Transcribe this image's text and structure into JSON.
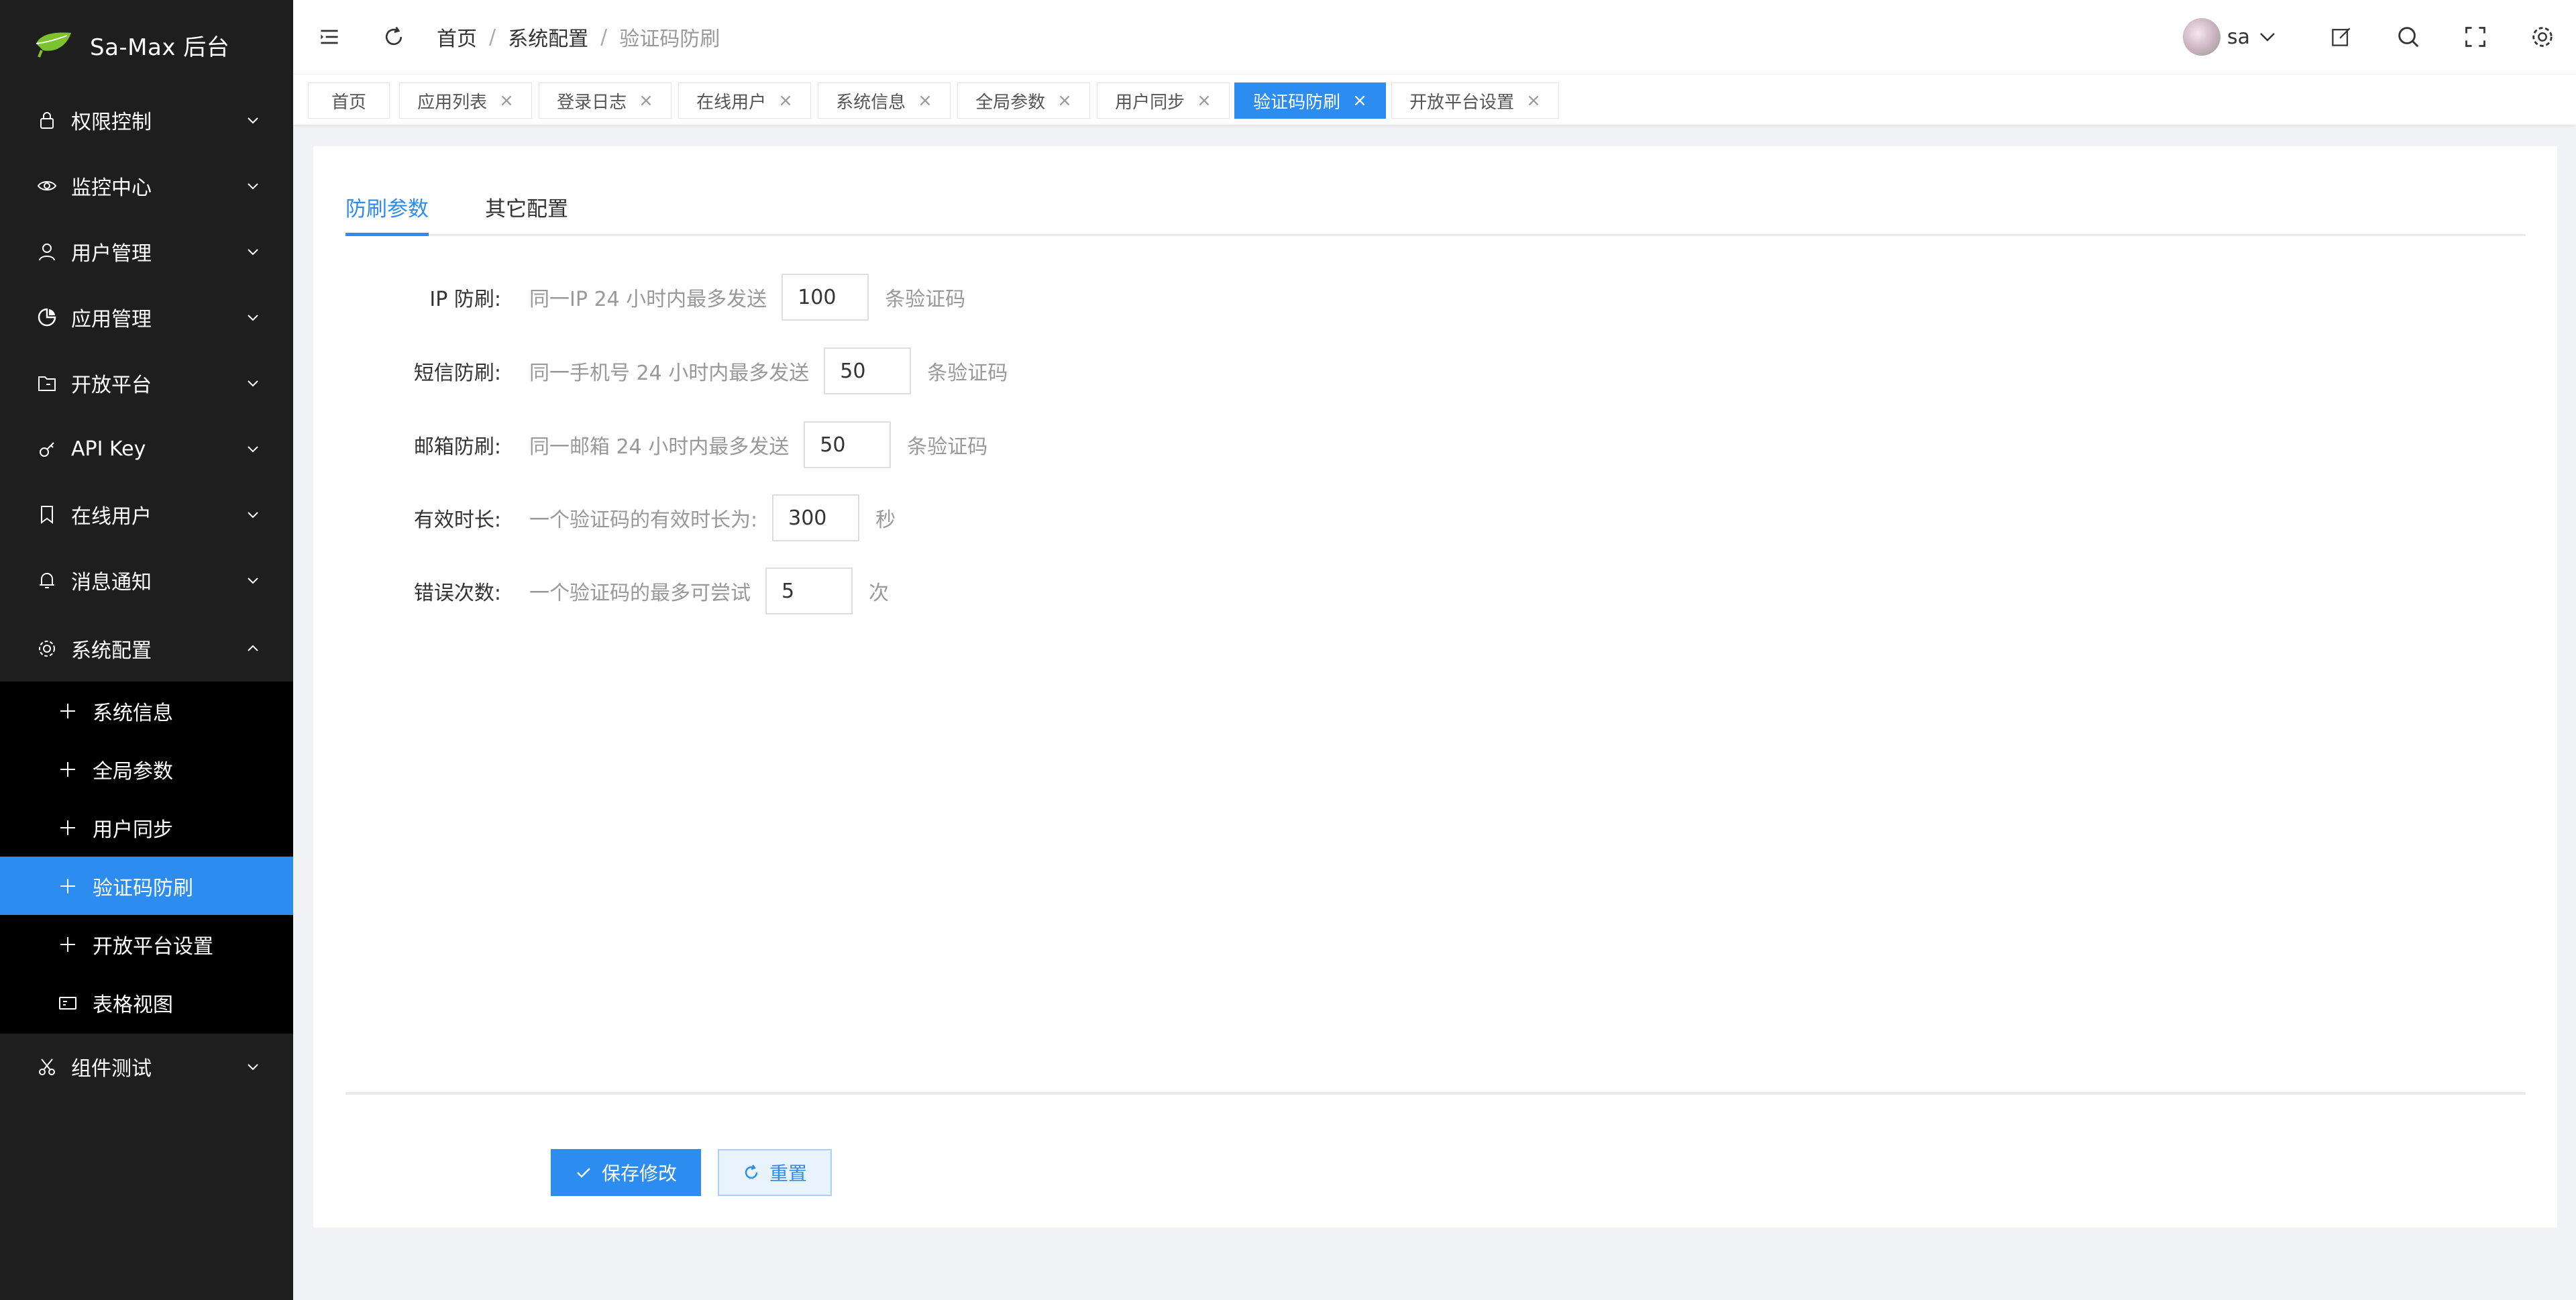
{
  "app": {
    "title": "Sa-Max 后台"
  },
  "sidebar": {
    "items": [
      {
        "label": "权限控制",
        "icon": "lock-icon"
      },
      {
        "label": "监控中心",
        "icon": "eye-icon"
      },
      {
        "label": "用户管理",
        "icon": "user-icon"
      },
      {
        "label": "应用管理",
        "icon": "chart-icon"
      },
      {
        "label": "开放平台",
        "icon": "folder-icon"
      },
      {
        "label": "API Key",
        "icon": "key-icon"
      },
      {
        "label": "在线用户",
        "icon": "bookmark-icon"
      },
      {
        "label": "消息通知",
        "icon": "bell-icon"
      },
      {
        "label": "系统配置",
        "icon": "gear-icon"
      },
      {
        "label": "组件测试",
        "icon": "scissors-icon"
      }
    ],
    "subitems": [
      {
        "label": "系统信息",
        "icon": "plus-icon"
      },
      {
        "label": "全局参数",
        "icon": "plus-icon"
      },
      {
        "label": "用户同步",
        "icon": "plus-icon"
      },
      {
        "label": "验证码防刷",
        "icon": "plus-icon",
        "active": true
      },
      {
        "label": "开放平台设置",
        "icon": "plus-icon"
      },
      {
        "label": "表格视图",
        "icon": "table-icon"
      }
    ]
  },
  "header": {
    "breadcrumb": [
      "首页",
      "系统配置",
      "验证码防刷"
    ],
    "separator": "/",
    "user": {
      "name": "sa"
    }
  },
  "tabs": [
    {
      "label": "首页",
      "closable": false
    },
    {
      "label": "应用列表",
      "closable": true
    },
    {
      "label": "登录日志",
      "closable": true
    },
    {
      "label": "在线用户",
      "closable": true
    },
    {
      "label": "系统信息",
      "closable": true
    },
    {
      "label": "全局参数",
      "closable": true
    },
    {
      "label": "用户同步",
      "closable": true
    },
    {
      "label": "验证码防刷",
      "closable": true,
      "active": true
    },
    {
      "label": "开放平台设置",
      "closable": true
    }
  ],
  "tab_close_glyph": "×",
  "content": {
    "tabs": [
      "防刷参数",
      "其它配置"
    ],
    "form": [
      {
        "label": "IP 防刷:",
        "desc": "同一IP 24 小时内最多发送",
        "value": "100",
        "unit": "条验证码"
      },
      {
        "label": "短信防刷:",
        "desc": "同一手机号 24 小时内最多发送",
        "value": "50",
        "unit": "条验证码"
      },
      {
        "label": "邮箱防刷:",
        "desc": "同一邮箱 24 小时内最多发送",
        "value": "50",
        "unit": "条验证码"
      },
      {
        "label": "有效时长:",
        "desc": "一个验证码的有效时长为:",
        "value": "300",
        "unit": "秒"
      },
      {
        "label": "错误次数:",
        "desc": "一个验证码的最多可尝试",
        "value": "5",
        "unit": "次"
      }
    ],
    "buttons": {
      "save": "保存修改",
      "reset": "重置"
    }
  },
  "colors": {
    "accent": "#2d8cf0",
    "sidebar_bg": "#1e1e1e",
    "submenu_bg": "#000000"
  }
}
